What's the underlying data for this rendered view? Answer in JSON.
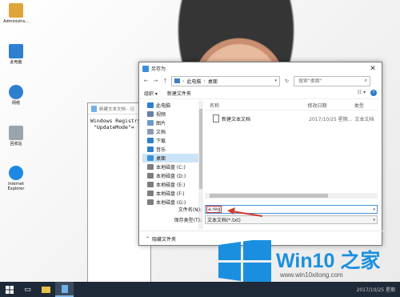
{
  "desktop": {
    "icons": [
      {
        "label": "Administra...",
        "icon": "user-folder-icon",
        "color": "#e0a43a"
      },
      {
        "label": "此电脑",
        "icon": "computer-icon",
        "color": "#2f7fd1"
      },
      {
        "label": "网络",
        "icon": "network-icon",
        "color": "#2f7fd1"
      },
      {
        "label": "回收站",
        "icon": "recycle-bin-icon",
        "color": "#9aa4ad"
      },
      {
        "label": "Internet Explorer",
        "icon": "ie-icon",
        "color": "#1e88e5"
      }
    ]
  },
  "notepad": {
    "title": "新建文本文档 - 记",
    "lines": "Windows Registry\n \"UpdateMode\"="
  },
  "dialog": {
    "title": "另存为",
    "close": "✕",
    "address": {
      "part1": "此电脑",
      "part2": "桌面"
    },
    "search_placeholder": "搜索\"桌面\"",
    "toolbar": {
      "organize": "组织 ▾",
      "new_folder": "新建文件夹",
      "view": "☷ ▾",
      "help": "?"
    },
    "nav_items": [
      {
        "label": "此电脑",
        "icon": "computer-icon",
        "color": "#2f7fd1"
      },
      {
        "label": "视频",
        "icon": "video-folder-icon",
        "color": "#6b7fa6"
      },
      {
        "label": "图片",
        "icon": "pictures-folder-icon",
        "color": "#6b9ac6"
      },
      {
        "label": "文档",
        "icon": "documents-folder-icon",
        "color": "#8a9bb0"
      },
      {
        "label": "下载",
        "icon": "download-icon",
        "color": "#2f7fd1"
      },
      {
        "label": "音乐",
        "icon": "music-icon",
        "color": "#2f7fd1"
      },
      {
        "label": "桌面",
        "icon": "desktop-folder-icon",
        "color": "#3c8fd8"
      },
      {
        "label": "本地磁盘 (C:)",
        "icon": "drive-icon",
        "color": "#7d7d7d"
      },
      {
        "label": "本地磁盘 (D:)",
        "icon": "drive-icon",
        "color": "#7d7d7d"
      },
      {
        "label": "本地磁盘 (E:)",
        "icon": "drive-icon",
        "color": "#7d7d7d"
      },
      {
        "label": "本地磁盘 (F:)",
        "icon": "drive-icon",
        "color": "#7d7d7d"
      },
      {
        "label": "本地磁盘 (G:)",
        "icon": "drive-icon",
        "color": "#7d7d7d"
      }
    ],
    "selected_nav": "桌面",
    "columns": {
      "name": "名称",
      "modified": "修改日期",
      "type": "类型"
    },
    "files": [
      {
        "name": "新建文本文档",
        "modified": "2017/10/25 星期...",
        "type": "文本文档"
      }
    ],
    "filename_label": "文件名(N):",
    "filename_value": "a.reg",
    "filetype_label": "保存类型(T):",
    "filetype_value": "文本文档(*.txt)",
    "hide_folders": "隐藏文件夹"
  },
  "watermark": {
    "title": "Win10 之家",
    "url": "www.win10xitong.com"
  },
  "taskbar": {
    "time": "2017/10/25 星期"
  },
  "colors": {
    "accent": "#1a8fe0",
    "annotation": "#d33a2c",
    "taskbar": "#1f2a38"
  }
}
